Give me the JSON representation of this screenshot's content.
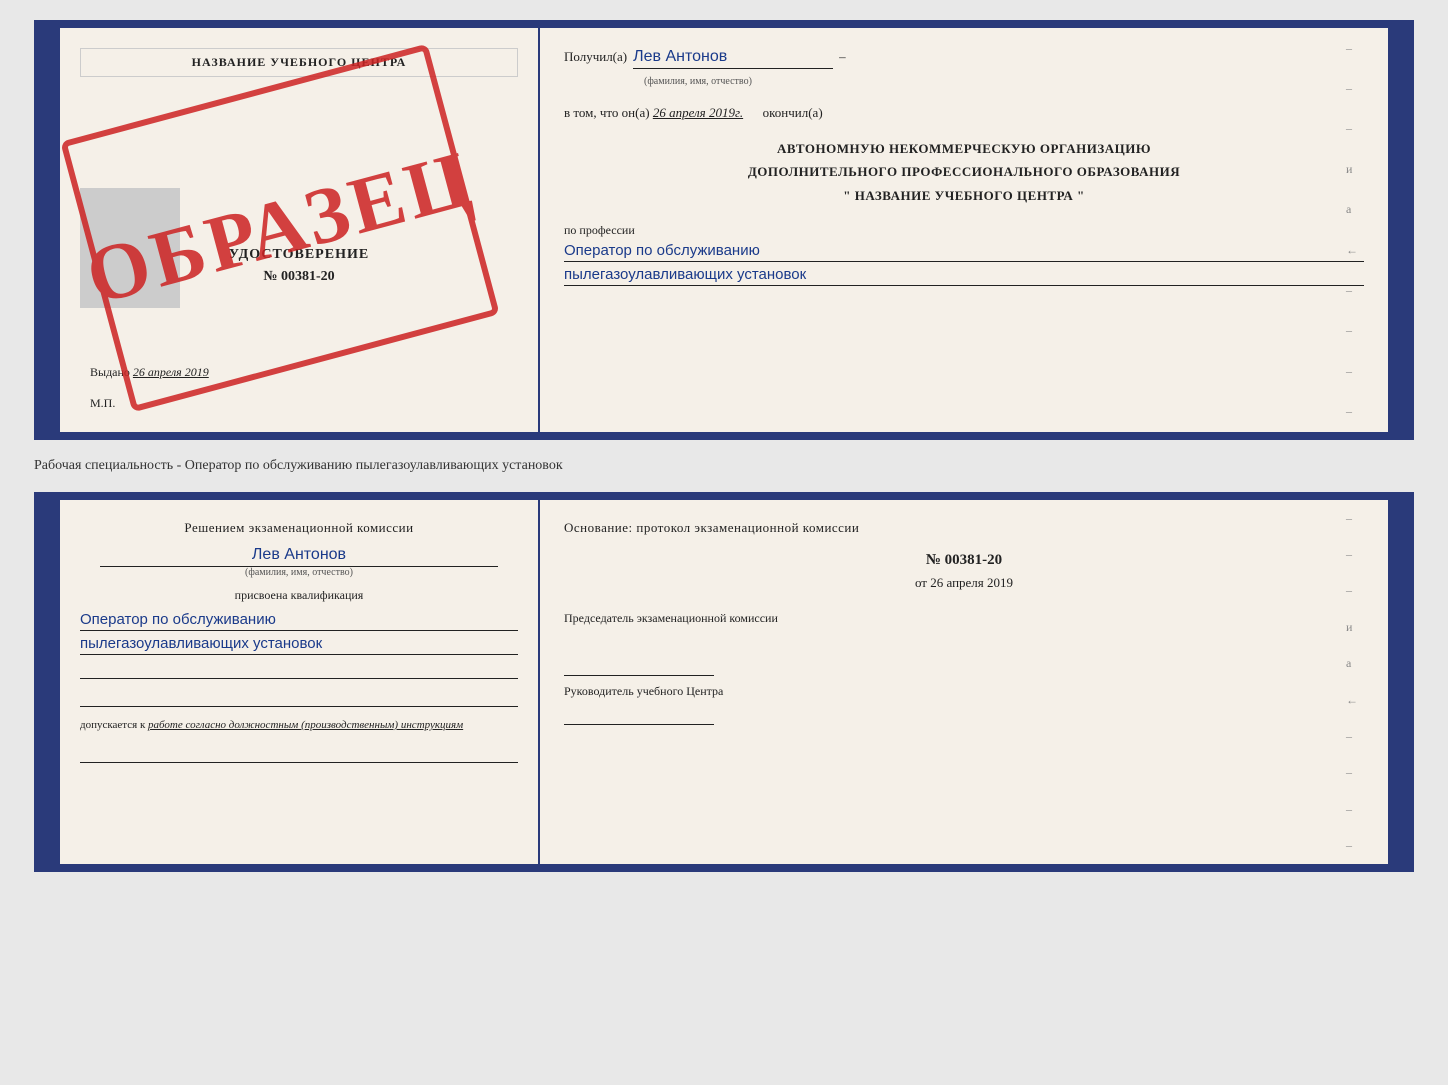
{
  "cert": {
    "left": {
      "training_center": "НАЗВАНИЕ УЧЕБНОГО ЦЕНТРА",
      "cert_label": "УДОСТОВЕРЕНИЕ",
      "cert_number": "№ 00381-20",
      "issued_label": "Выдано",
      "issued_date": "26 апреля 2019",
      "mp_label": "М.П.",
      "stamp_text": "ОБРАЗЕЦ"
    },
    "right": {
      "received_prefix": "Получил(а)",
      "received_name": "Лев Антонов",
      "fio_subtitle": "(фамилия, имя, отчество)",
      "dash": "–",
      "in_that": "в том, что он(а)",
      "date_completed": "26 апреля 2019г.",
      "completed_label": "окончил(а)",
      "institution_line1": "АВТОНОМНУЮ НЕКОММЕРЧЕСКУЮ ОРГАНИЗАЦИЮ",
      "institution_line2": "ДОПОЛНИТЕЛЬНОГО ПРОФЕССИОНАЛЬНОГО ОБРАЗОВАНИЯ",
      "institution_line3": "\"   НАЗВАНИЕ УЧЕБНОГО ЦЕНТРА   \"",
      "profession_label": "по профессии",
      "profession_line1": "Оператор по обслуживанию",
      "profession_line2": "пылегазоулавливающих установок",
      "dashes": [
        "–",
        "–",
        "–",
        "и",
        "а",
        "←",
        "–",
        "–",
        "–",
        "–"
      ]
    }
  },
  "between_label": "Рабочая специальность - Оператор по обслуживанию пылегазоулавливающих установок",
  "qual": {
    "left": {
      "decision_text": "Решением экзаменационной комиссии",
      "person_name": "Лев Антонов",
      "fio_subtitle": "(фамилия, имя, отчество)",
      "assigned_text": "присвоена квалификация",
      "qual_line1": "Оператор по обслуживанию",
      "qual_line2": "пылегазоулавливающих установок",
      "допускается_prefix": "допускается к",
      "допускается_value": "работе согласно должностным (производственным) инструкциям"
    },
    "right": {
      "osnov_text": "Основание: протокол экзаменационной комиссии",
      "protocol_number": "№ 00381-20",
      "from_prefix": "от",
      "from_date": "26 апреля 2019",
      "chairman_label": "Председатель экзаменационной комиссии",
      "director_label": "Руководитель учебного Центра",
      "dashes": [
        "–",
        "–",
        "–",
        "и",
        "а",
        "←",
        "–",
        "–",
        "–",
        "–"
      ]
    }
  }
}
